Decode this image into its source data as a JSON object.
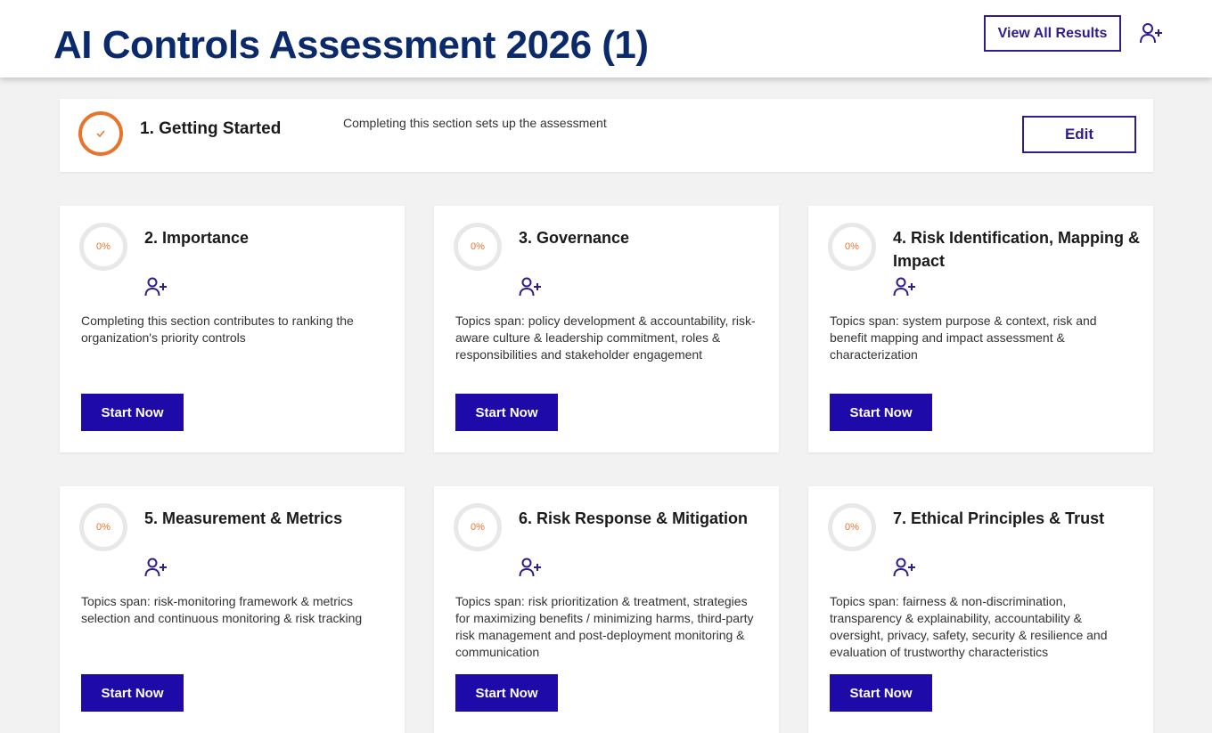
{
  "header": {
    "title": "AI Controls Assessment 2026 (1)",
    "view_all_label": "View All Results",
    "add_user_icon": "add-user-icon"
  },
  "getting_started": {
    "title": "1. Getting Started",
    "description": "Completing this section sets up the assessment",
    "edit_label": "Edit",
    "status_icon": "check-icon"
  },
  "colors": {
    "brand_navy": "#0b2a6b",
    "button_indigo": "#1e0aa8",
    "accent_orange": "#e8742c",
    "outline_purple": "#2d1e8c"
  },
  "sections": [
    {
      "progress": "0%",
      "title": "2. Importance",
      "description": "Completing this section contributes to ranking the organization's priority controls",
      "button": "Start Now"
    },
    {
      "progress": "0%",
      "title": "3. Governance",
      "description": "Topics span: policy development & accountability, risk-aware culture & leadership commitment, roles & responsibilities and stakeholder engagement",
      "button": "Start Now"
    },
    {
      "progress": "0%",
      "title": "4. Risk Identification, Mapping & Impact",
      "description": "Topics span: system purpose & context, risk and benefit mapping and impact assessment & characterization",
      "button": "Start Now"
    },
    {
      "progress": "0%",
      "title": "5. Measurement & Metrics",
      "description": "Topics span: risk-monitoring framework & metrics selection and continuous monitoring & risk tracking",
      "button": "Start Now"
    },
    {
      "progress": "0%",
      "title": "6. Risk Response & Mitigation",
      "description": "Topics span: risk prioritization & treatment, strategies for maximizing benefits / minimizing harms, third-party risk management and post-deployment monitoring & communication",
      "button": "Start Now"
    },
    {
      "progress": "0%",
      "title": "7. Ethical Principles & Trust",
      "description": "Topics span: fairness & non-discrimination, transparency & explainability, accountability & oversight, privacy, safety, security & resilience and evaluation of trustworthy characteristics",
      "button": "Start Now"
    }
  ]
}
